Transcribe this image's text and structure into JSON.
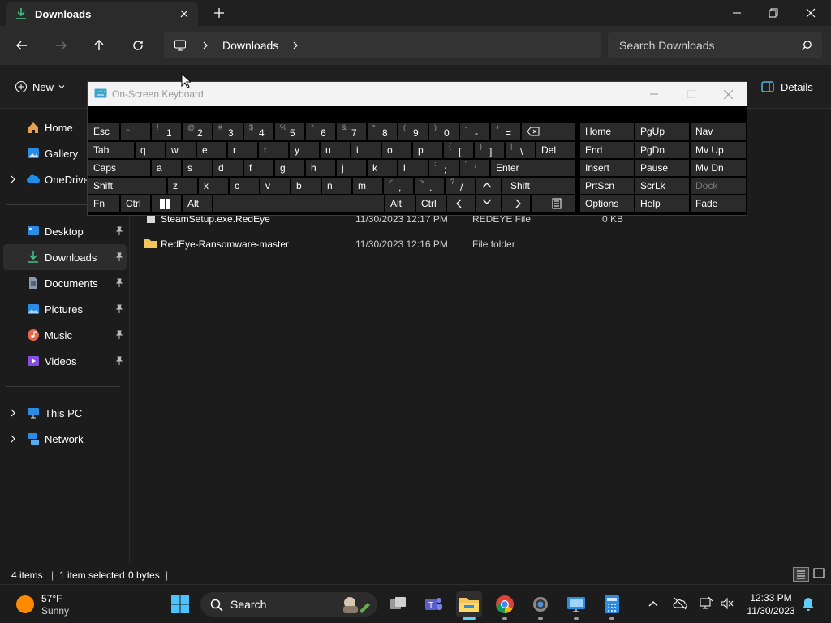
{
  "window": {
    "tab_title": "Downloads",
    "breadcrumb_current": "Downloads",
    "search_placeholder": "Search Downloads"
  },
  "toolbar": {
    "new_label": "New",
    "details_label": "Details"
  },
  "sidebar": {
    "items": [
      {
        "label": "Home",
        "icon": "home-icon"
      },
      {
        "label": "Gallery",
        "icon": "gallery-icon"
      },
      {
        "label": "OneDrive",
        "icon": "onedrive-icon"
      },
      {
        "label": "Desktop",
        "icon": "desktop-icon"
      },
      {
        "label": "Downloads",
        "icon": "download-icon"
      },
      {
        "label": "Documents",
        "icon": "documents-icon"
      },
      {
        "label": "Pictures",
        "icon": "pictures-icon"
      },
      {
        "label": "Music",
        "icon": "music-icon"
      },
      {
        "label": "Videos",
        "icon": "videos-icon"
      },
      {
        "label": "This PC",
        "icon": "pc-icon"
      },
      {
        "label": "Network",
        "icon": "network-icon"
      }
    ]
  },
  "files": [
    {
      "name": "SteamSetup.exe.RedEye",
      "date": "11/30/2023 12:17 PM",
      "type": "REDEYE File",
      "size": "0 KB"
    },
    {
      "name": "RedEye-Ransomware-master",
      "date": "11/30/2023 12:16 PM",
      "type": "File folder",
      "size": ""
    }
  ],
  "status": {
    "items": "4 items",
    "selected": "1 item selected",
    "size": "0 bytes"
  },
  "osk": {
    "title": "On-Screen Keyboard",
    "keys": {
      "esc": "Esc",
      "tab": "Tab",
      "caps": "Caps",
      "shift": "Shift",
      "fn": "Fn",
      "ctrl": "Ctrl",
      "alt": "Alt",
      "del": "Del",
      "enter": "Enter",
      "home": "Home",
      "pgup": "PgUp",
      "nav": "Nav",
      "end": "End",
      "pgdn": "PgDn",
      "mvup": "Mv Up",
      "insert": "Insert",
      "pause": "Pause",
      "mvdn": "Mv Dn",
      "prtscn": "PrtScn",
      "scrlk": "ScrLk",
      "dock": "Dock",
      "options": "Options",
      "help": "Help",
      "fade": "Fade",
      "row1_shift": [
        "~ `",
        "!",
        "@",
        "#",
        "$",
        "%",
        "^",
        "&",
        "*",
        "(",
        ")",
        "-",
        "+"
      ],
      "row1_main": [
        "",
        "1",
        "2",
        "3",
        "4",
        "5",
        "6",
        "7",
        "8",
        "9",
        "0",
        "-",
        "="
      ],
      "row2": [
        "q",
        "w",
        "e",
        "r",
        "t",
        "y",
        "u",
        "i",
        "o",
        "p"
      ],
      "row2_brackets": [
        {
          "s": "{",
          "m": "["
        },
        {
          "s": "}",
          "m": "]"
        },
        {
          "s": "|",
          "m": "\\"
        }
      ],
      "row3": [
        "a",
        "s",
        "d",
        "f",
        "g",
        "h",
        "j",
        "k",
        "l"
      ],
      "row3_punct": [
        {
          "s": ":",
          "m": ";"
        },
        {
          "s": "\"",
          "m": "'"
        }
      ],
      "row4": [
        "z",
        "x",
        "c",
        "v",
        "b",
        "n",
        "m"
      ],
      "row4_punct": [
        {
          "s": "<",
          "m": ","
        },
        {
          "s": ">",
          "m": "."
        },
        {
          "s": "?",
          "m": "/"
        }
      ]
    }
  },
  "taskbar": {
    "temperature": "57°F",
    "condition": "Sunny",
    "search_label": "Search",
    "time": "12:33 PM",
    "date": "11/30/2023"
  },
  "colors": {
    "accent": "#60cdff",
    "folder": "#f2c55c"
  }
}
